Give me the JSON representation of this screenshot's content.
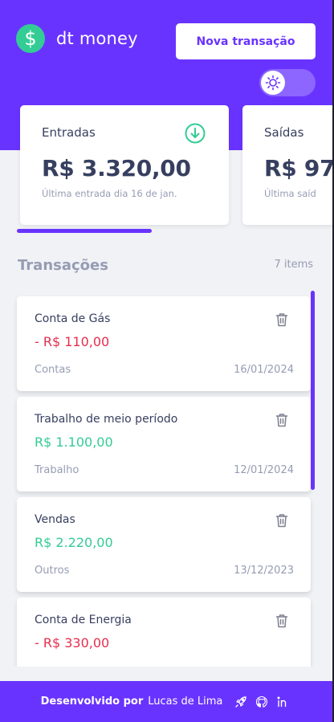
{
  "app": {
    "title": "dt money",
    "logo_symbol": "$"
  },
  "header": {
    "new_transaction_label": "Nova transação",
    "theme_toggle_icon": "sun-icon"
  },
  "summary": {
    "income": {
      "label": "Entradas",
      "value": "R$ 3.320,00",
      "subtitle": "Última entrada dia 16 de jan.",
      "icon": "arrow-circle-down-icon"
    },
    "outcome": {
      "label": "Saídas",
      "value": "R$ 97",
      "subtitle": "Última saíd",
      "icon": "arrow-circle-up-icon"
    }
  },
  "transactions": {
    "title": "Transações",
    "count": "7 items",
    "items": [
      {
        "description": "Conta de Gás",
        "amount": "- R$ 110,00",
        "type": "outcome",
        "category": "Contas",
        "date": "16/01/2024"
      },
      {
        "description": "Trabalho de meio período",
        "amount": "R$ 1.100,00",
        "type": "income",
        "category": "Trabalho",
        "date": "12/01/2024"
      },
      {
        "description": "Vendas",
        "amount": "R$ 2.220,00",
        "type": "income",
        "category": "Outros",
        "date": "13/12/2023"
      },
      {
        "description": "Conta de Energia",
        "amount": "- R$ 330,00",
        "type": "outcome",
        "category": "",
        "date": ""
      }
    ]
  },
  "footer": {
    "developed_by": "Desenvolvido por",
    "author": "Lucas de Lima",
    "icons": [
      "rocket-icon",
      "github-icon",
      "linkedin-icon"
    ]
  },
  "colors": {
    "primary": "#6933ff",
    "income": "#33cc95",
    "outcome": "#e52e4d",
    "text": "#363f5f",
    "muted": "#969cb3",
    "background": "#f0f2f5"
  }
}
